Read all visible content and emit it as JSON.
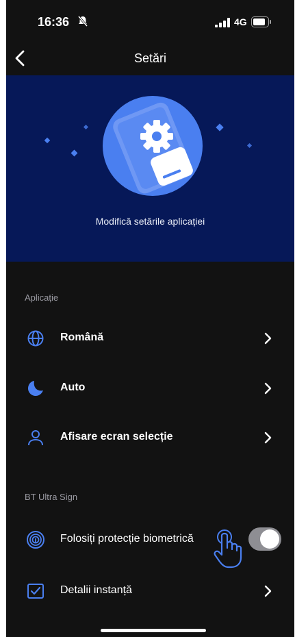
{
  "status_bar": {
    "time": "16:36",
    "network": "4G"
  },
  "nav": {
    "title": "Setări"
  },
  "hero": {
    "caption": "Modifică setările aplicației"
  },
  "sections": {
    "app_header": "Aplicație",
    "sign_header": "BT Ultra Sign"
  },
  "rows": {
    "language": "Română",
    "theme": "Auto",
    "display": "Afisare ecran selecție",
    "biometric": "Folosiți protecție biometrică",
    "instance": "Detalii instanță"
  },
  "toggle": {
    "biometric_state": "on"
  },
  "colors": {
    "background": "#121212",
    "hero_background": "#061858",
    "accent": "#4a7ff0",
    "toggle_track": "#8e8e93"
  },
  "icons": {
    "language": "globe-icon",
    "theme": "moon-icon",
    "display": "user-icon",
    "biometric": "fingerprint-icon",
    "instance": "checkbox-icon"
  }
}
